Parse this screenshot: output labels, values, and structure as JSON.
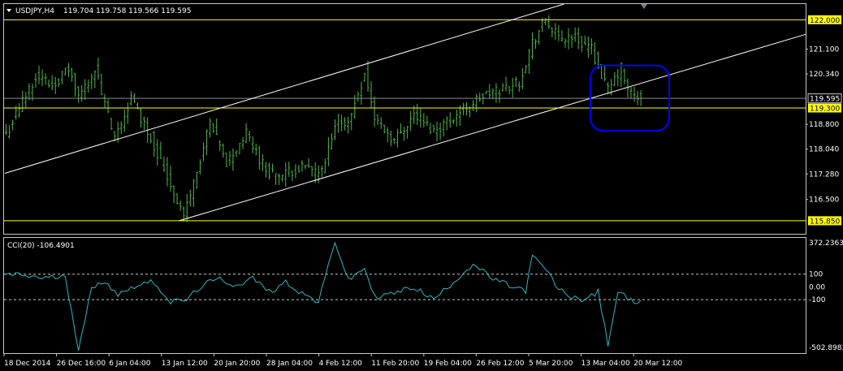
{
  "header": {
    "symbol": "USDJPY,H4",
    "ohlc": "119.704 119.758 119.566 119.595"
  },
  "indicator": {
    "label": "CCI(20) -106.4901"
  },
  "colors": {
    "background": "#000000",
    "price_bars": "#4fb54a",
    "cci_line": "#2fb7c0",
    "channel": "#ffffff",
    "support_resistance": "#ffff00",
    "highlight": "#0000ff",
    "frame": "#c8c8c8"
  },
  "chart_data": [
    {
      "type": "bar",
      "title": "USDJPY,H4",
      "ylim": [
        115.45,
        122.48
      ],
      "y_ticks": [
        "121.100",
        "120.340",
        "118.800",
        "118.040",
        "117.280",
        "116.500"
      ],
      "x_tick_labels": [
        "18 Dec 2014",
        "26 Dec 16:00",
        "6 Jan 04:00",
        "13 Jan 12:00",
        "20 Jan 20:00",
        "28 Jan 04:00",
        "4 Feb 12:00",
        "11 Feb 20:00",
        "19 Feb 04:00",
        "26 Feb 12:00",
        "5 Mar 20:00",
        "13 Mar 04:00",
        "20 Mar 12:00"
      ],
      "current_price": 119.595,
      "current_price_label": "119.595",
      "horizontal_levels": [
        {
          "value": 122.0,
          "label": "122.000"
        },
        {
          "value": 119.3,
          "label": "119.300"
        },
        {
          "value": 115.85,
          "label": "115.850"
        }
      ],
      "channel_lines": [
        {
          "from": [
            0,
            117.3
          ],
          "to": [
            170,
            122.48
          ]
        },
        {
          "from": [
            53,
            115.85
          ],
          "to": [
            240,
            121.45
          ]
        }
      ],
      "highlight": {
        "x_range": [
          178,
          202
        ],
        "y_range": [
          118.6,
          120.6
        ]
      },
      "close_anchors": [
        [
          0,
          118.5
        ],
        [
          4,
          119.3
        ],
        [
          9,
          120.3
        ],
        [
          14,
          120.0
        ],
        [
          19,
          120.5
        ],
        [
          22,
          119.6
        ],
        [
          27,
          120.5
        ],
        [
          33,
          118.3
        ],
        [
          38,
          119.6
        ],
        [
          44,
          118.4
        ],
        [
          49,
          117.2
        ],
        [
          54,
          116.0
        ],
        [
          57,
          117.0
        ],
        [
          62,
          118.8
        ],
        [
          67,
          117.6
        ],
        [
          73,
          118.5
        ],
        [
          79,
          117.4
        ],
        [
          84,
          117.2
        ],
        [
          89,
          117.5
        ],
        [
          96,
          117.3
        ],
        [
          101,
          119.0
        ],
        [
          104,
          118.8
        ],
        [
          109,
          120.4
        ],
        [
          112,
          119.0
        ],
        [
          118,
          118.3
        ],
        [
          124,
          119.1
        ],
        [
          130,
          118.6
        ],
        [
          137,
          119.1
        ],
        [
          144,
          119.6
        ],
        [
          151,
          119.9
        ],
        [
          156,
          120.1
        ],
        [
          160,
          121.3
        ],
        [
          164,
          122.0
        ],
        [
          168,
          121.4
        ],
        [
          172,
          121.5
        ],
        [
          178,
          121.1
        ],
        [
          183,
          119.8
        ],
        [
          187,
          120.5
        ],
        [
          189,
          119.8
        ],
        [
          193,
          119.6
        ]
      ]
    },
    {
      "type": "line",
      "title": "CCI(20)",
      "ylim": [
        -520,
        385
      ],
      "y_ticks": [
        "372.2363",
        "100",
        "0.00",
        "-100",
        "-502.8983"
      ],
      "levels": [
        100,
        -100
      ],
      "last_value": -106.4901,
      "anchors": [
        [
          0,
          100
        ],
        [
          5,
          90
        ],
        [
          12,
          70
        ],
        [
          18,
          80
        ],
        [
          22,
          -480
        ],
        [
          26,
          -20
        ],
        [
          30,
          50
        ],
        [
          34,
          -60
        ],
        [
          40,
          20
        ],
        [
          45,
          40
        ],
        [
          50,
          -120
        ],
        [
          55,
          -100
        ],
        [
          60,
          20
        ],
        [
          65,
          60
        ],
        [
          70,
          10
        ],
        [
          75,
          70
        ],
        [
          80,
          -40
        ],
        [
          85,
          40
        ],
        [
          90,
          -50
        ],
        [
          95,
          -120
        ],
        [
          100,
          360
        ],
        [
          104,
          50
        ],
        [
          109,
          150
        ],
        [
          112,
          -80
        ],
        [
          118,
          -50
        ],
        [
          124,
          0
        ],
        [
          130,
          -100
        ],
        [
          136,
          40
        ],
        [
          142,
          180
        ],
        [
          148,
          60
        ],
        [
          154,
          0
        ],
        [
          158,
          -30
        ],
        [
          160,
          240
        ],
        [
          164,
          140
        ],
        [
          168,
          -20
        ],
        [
          172,
          -80
        ],
        [
          176,
          -100
        ],
        [
          180,
          -40
        ],
        [
          183,
          -450
        ],
        [
          186,
          -40
        ],
        [
          190,
          -110
        ],
        [
          193,
          -106.49
        ]
      ]
    }
  ]
}
